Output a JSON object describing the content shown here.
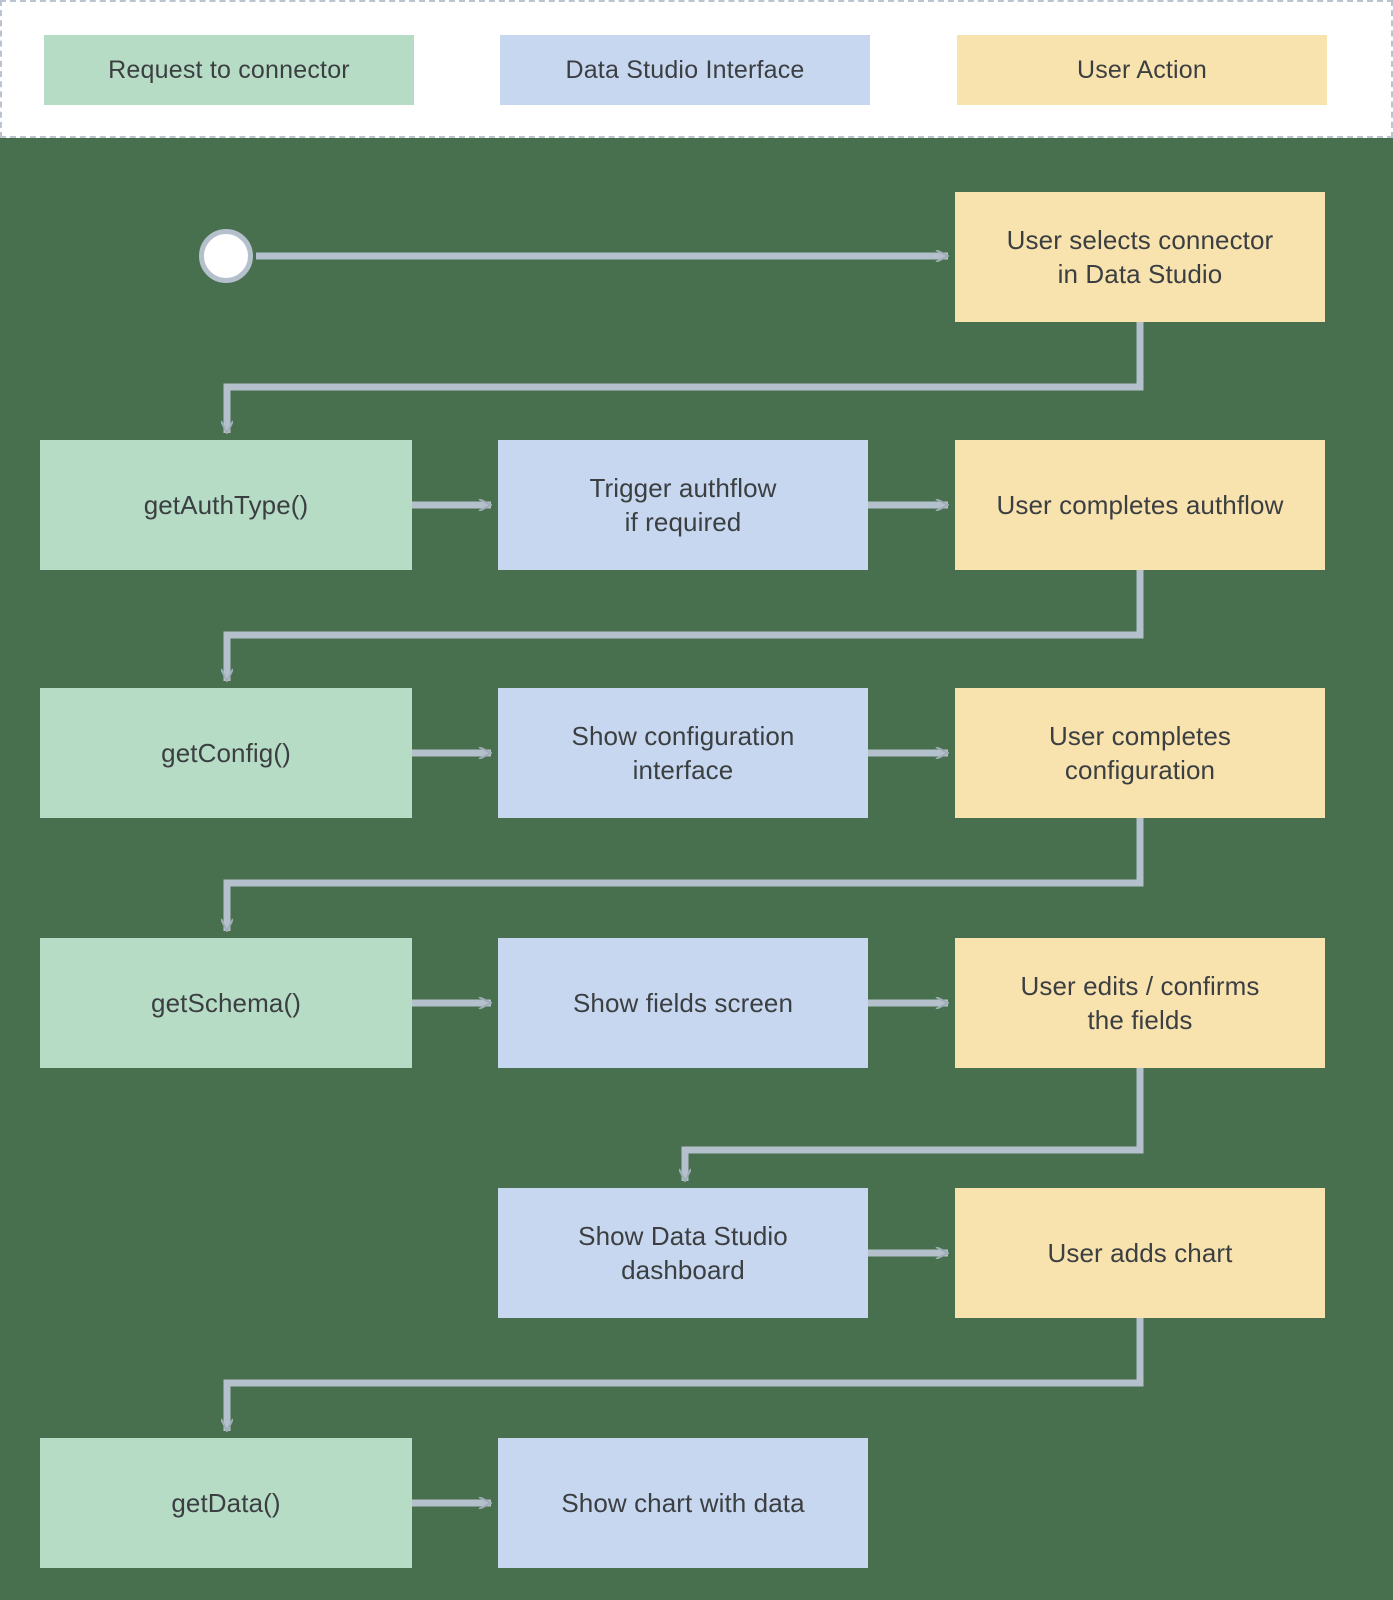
{
  "legend": {
    "items": [
      {
        "label": "Request to connector",
        "color": "#b7dcc6",
        "key": "request-to-connector"
      },
      {
        "label": "Data Studio Interface",
        "color": "#c7d7ef",
        "key": "data-studio-interface"
      },
      {
        "label": "User Action",
        "color": "#f8e3ae",
        "key": "user-action"
      }
    ]
  },
  "canvas": {
    "background_color": "#49704e",
    "edge_color": "#b4c0cb"
  },
  "flow": {
    "start_node": {
      "shape": "circle",
      "label": ""
    },
    "nodes": [
      {
        "id": "user-selects-connector",
        "label_line1": "User selects connector",
        "label_line2": "in Data Studio",
        "category": "User Action",
        "color": "#f8e3ae"
      },
      {
        "id": "get-auth-type",
        "label_line1": "getAuthType()",
        "label_line2": "",
        "category": "Request to connector",
        "color": "#b7dcc6"
      },
      {
        "id": "trigger-authflow",
        "label_line1": "Trigger authflow",
        "label_line2": "if required",
        "category": "Data Studio Interface",
        "color": "#c7d7ef"
      },
      {
        "id": "user-completes-authflow",
        "label_line1": "User completes authflow",
        "label_line2": "",
        "category": "User Action",
        "color": "#f8e3ae"
      },
      {
        "id": "get-config",
        "label_line1": "getConfig()",
        "label_line2": "",
        "category": "Request to connector",
        "color": "#b7dcc6"
      },
      {
        "id": "show-configuration-interface",
        "label_line1": "Show configuration",
        "label_line2": "interface",
        "category": "Data Studio Interface",
        "color": "#c7d7ef"
      },
      {
        "id": "user-completes-configuration",
        "label_line1": "User completes",
        "label_line2": "configuration",
        "category": "User Action",
        "color": "#f8e3ae"
      },
      {
        "id": "get-schema",
        "label_line1": "getSchema()",
        "label_line2": "",
        "category": "Request to connector",
        "color": "#b7dcc6"
      },
      {
        "id": "show-fields-screen",
        "label_line1": "Show fields screen",
        "label_line2": "",
        "category": "Data Studio Interface",
        "color": "#c7d7ef"
      },
      {
        "id": "user-edits-confirms-fields",
        "label_line1": "User edits / confirms",
        "label_line2": "the fields",
        "category": "User Action",
        "color": "#f8e3ae"
      },
      {
        "id": "show-data-studio-dashboard",
        "label_line1": "Show Data Studio",
        "label_line2": "dashboard",
        "category": "Data Studio Interface",
        "color": "#c7d7ef"
      },
      {
        "id": "user-adds-chart",
        "label_line1": "User adds chart",
        "label_line2": "",
        "category": "User Action",
        "color": "#f8e3ae"
      },
      {
        "id": "get-data",
        "label_line1": "getData()",
        "label_line2": "",
        "category": "Request to connector",
        "color": "#b7dcc6"
      },
      {
        "id": "show-chart-with-data",
        "label_line1": "Show chart with data",
        "label_line2": "",
        "category": "Data Studio Interface",
        "color": "#c7d7ef"
      }
    ],
    "edges": [
      {
        "from": "start",
        "to": "user-selects-connector"
      },
      {
        "from": "user-selects-connector",
        "to": "get-auth-type"
      },
      {
        "from": "get-auth-type",
        "to": "trigger-authflow"
      },
      {
        "from": "trigger-authflow",
        "to": "user-completes-authflow"
      },
      {
        "from": "user-completes-authflow",
        "to": "get-config"
      },
      {
        "from": "get-config",
        "to": "show-configuration-interface"
      },
      {
        "from": "show-configuration-interface",
        "to": "user-completes-configuration"
      },
      {
        "from": "user-completes-configuration",
        "to": "get-schema"
      },
      {
        "from": "get-schema",
        "to": "show-fields-screen"
      },
      {
        "from": "show-fields-screen",
        "to": "user-edits-confirms-fields"
      },
      {
        "from": "user-edits-confirms-fields",
        "to": "show-data-studio-dashboard"
      },
      {
        "from": "show-data-studio-dashboard",
        "to": "user-adds-chart"
      },
      {
        "from": "user-adds-chart",
        "to": "get-data"
      },
      {
        "from": "get-data",
        "to": "show-chart-with-data"
      }
    ]
  }
}
